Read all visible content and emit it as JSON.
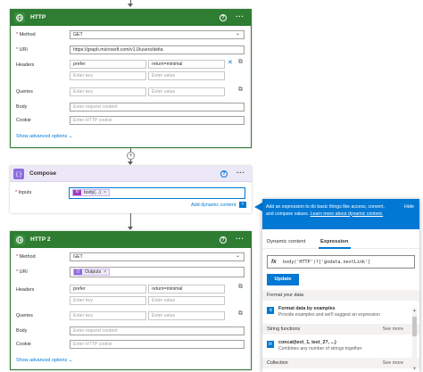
{
  "http1": {
    "title": "HTTP",
    "method_label": "Method",
    "method_value": "GET",
    "uri_label": "URI",
    "uri_value": "https://graph.microsoft.com/v1.0/users/delta",
    "headers_label": "Headers",
    "header_key": "prefer",
    "header_value": "return=minimal",
    "key_placeholder": "Enter key",
    "value_placeholder": "Enter value",
    "queries_label": "Queries",
    "body_label": "Body",
    "body_placeholder": "Enter request content",
    "cookie_label": "Cookie",
    "cookie_placeholder": "Enter HTTP cookie",
    "show_advanced": "Show advanced options"
  },
  "compose": {
    "title": "Compose",
    "inputs_label": "Inputs",
    "token_label": "body(...)",
    "add_dynamic": "Add dynamic content"
  },
  "http2": {
    "title": "HTTP 2",
    "method_label": "Method",
    "method_value": "GET",
    "uri_label": "URI",
    "uri_token": "Outputs",
    "headers_label": "Headers",
    "header_key": "prefer",
    "header_value": "return=minimal",
    "key_placeholder": "Enter key",
    "value_placeholder": "Enter value",
    "queries_label": "Queries",
    "body_label": "Body",
    "body_placeholder": "Enter request content",
    "cookie_label": "Cookie",
    "cookie_placeholder": "Enter HTTP cookie",
    "show_advanced": "Show advanced options"
  },
  "panel": {
    "banner_text": "Add an expression to do basic things like access, convert, and compare values.",
    "banner_link": "Learn more about dynamic content.",
    "hide": "Hide",
    "tab_dynamic": "Dynamic content",
    "tab_expression": "Expression",
    "expression": "body('HTTP')?['@odata.nextLink']",
    "update_button": "Update",
    "format_section": "Format your data",
    "format_item_name": "Format data by examples",
    "format_item_desc": "Provide examples and we'll suggest an expression",
    "string_section": "String functions",
    "see_more": "See more",
    "string_item_name": "concat(text_1, text_2?, ...)",
    "string_item_desc": "Combines any number of strings together",
    "collection_section": "Collection",
    "see_more_2": "See more"
  },
  "icons": {
    "http": "globe-icon",
    "compose": "compose-braces-icon",
    "help": "question-icon",
    "more": "ellipsis-icon"
  },
  "colors": {
    "http_header": "#2e7d32",
    "compose_header": "#ece8f7",
    "accent": "#0078d4",
    "fx_token": "#a33bc2"
  }
}
